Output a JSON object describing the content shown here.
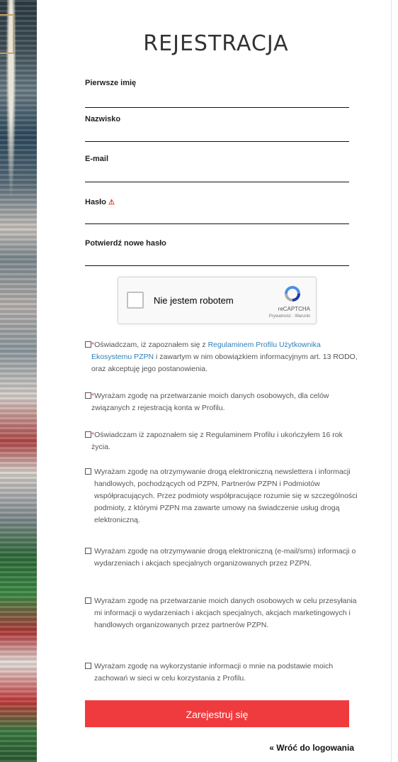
{
  "page": {
    "title": "REJESTRACJA"
  },
  "fields": [
    {
      "label": "Pierwsze imię",
      "value": ""
    },
    {
      "label": "Nazwisko",
      "value": ""
    },
    {
      "label": "E-mail",
      "value": ""
    },
    {
      "label": "Hasło",
      "value": ""
    },
    {
      "label": "Potwierdź nowe hasło",
      "value": ""
    }
  ],
  "captcha": {
    "label": "Nie jestem robotem",
    "brand": "reCAPTCHA",
    "links": "Prywatność - Warunki"
  },
  "consents": [
    {
      "required": "*",
      "pre": "Oświadczam, iż zapoznałem się z ",
      "link": "Regulaminem Profilu Użytkownika Ekosystemu PZPN",
      "post": " i zawartym w nim obowiązkiem informacyjnym art. 13 RODO, oraz akceptuję jego postanowienia."
    },
    {
      "required": "*",
      "text": "Wyrażam zgodę na przetwarzanie moich danych osobowych, dla celów związanych z rejestracją konta w Profilu."
    },
    {
      "required": "*",
      "text": "Oświadczam iż zapoznałem się z Regulaminem Profilu i ukończyłem 16 rok życia."
    },
    {
      "text": "Wyrażam zgodę na otrzymywanie drogą elektroniczną newslettera i informacji handlowych, pochodzących od PZPN, Partnerów PZPN i Podmiotów współpracujących. Przez podmioty współpracujące rozumie się w szczególności podmioty, z którymi PZPN ma zawarte umowy na świadczenie usług drogą elektroniczną."
    },
    {
      "text": "Wyrażam zgodę na otrzymywanie drogą elektroniczną (e-mail/sms) informacji o wydarzeniach i akcjach specjalnych organizowanych przez PZPN."
    },
    {
      "text": "Wyrażam zgodę na przetwarzanie moich danych osobowych w celu przesyłania mi informacji o wydarzeniach i akcjach specjalnych, akcjach marketingowych i handlowych organizowanych przez partnerów PZPN."
    },
    {
      "text": "Wyrażam zgodę na wykorzystanie informacji o mnie na podstawie moich zachowań w sieci w celu korzystania z Profilu."
    }
  ],
  "submit_label": "Zarejestruj się",
  "back_link": "« Wróć do logowania",
  "colors": {
    "accent": "#ef3b3e",
    "link": "#2f7fb8",
    "required": "#e53935"
  },
  "icons": {
    "password_warning": "warning-icon",
    "captcha_logo": "recaptcha-icon"
  }
}
